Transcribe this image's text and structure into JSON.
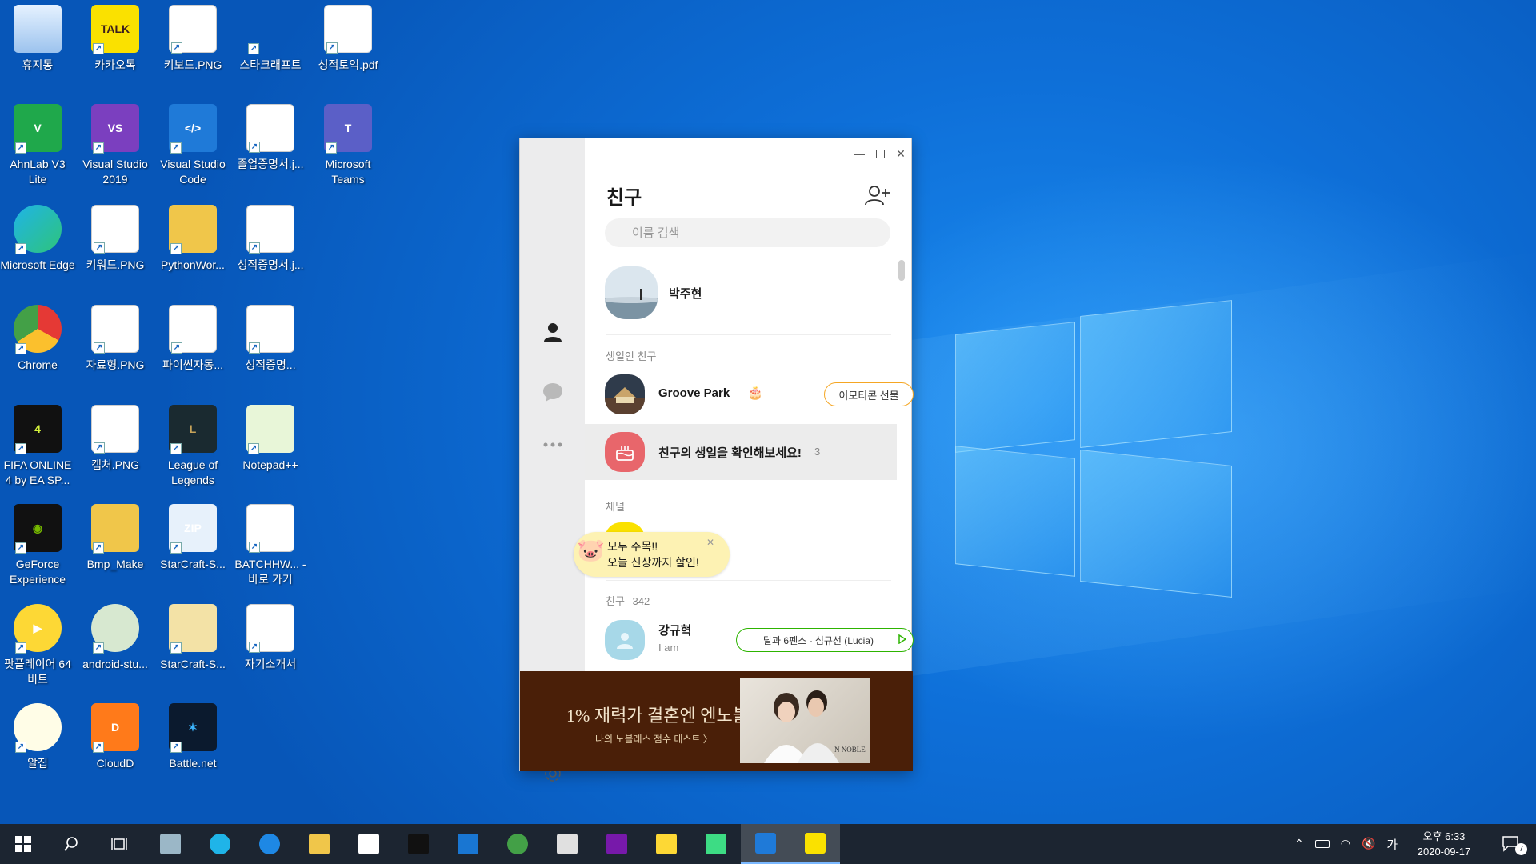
{
  "desktop": {
    "icons": [
      {
        "label": "휴지통",
        "icon": "recycle-bin-icon"
      },
      {
        "label": "카카오톡",
        "icon": "kakaotalk-icon"
      },
      {
        "label": "키보드.PNG",
        "icon": "image-file-icon"
      },
      {
        "label": "스타크래프트",
        "icon": "starcraft-icon"
      },
      {
        "label": "성적토익.pdf",
        "icon": "pdf-file-icon"
      },
      {
        "label": "AhnLab V3 Lite",
        "icon": "ahnlab-icon"
      },
      {
        "label": "Visual Studio 2019",
        "icon": "visual-studio-icon"
      },
      {
        "label": "Visual Studio Code",
        "icon": "vscode-icon"
      },
      {
        "label": "졸업증명서.j...",
        "icon": "image-file-icon"
      },
      {
        "label": "Microsoft Teams",
        "icon": "teams-icon"
      },
      {
        "label": "Microsoft Edge",
        "icon": "edge-icon"
      },
      {
        "label": "키워드.PNG",
        "icon": "image-file-icon"
      },
      {
        "label": "PythonWor...",
        "icon": "folder-icon"
      },
      {
        "label": "성적증명서.j...",
        "icon": "image-file-icon"
      },
      {
        "label": "Chrome",
        "icon": "chrome-icon"
      },
      {
        "label": "자료형.PNG",
        "icon": "image-file-icon"
      },
      {
        "label": "파이썬자동...",
        "icon": "image-file-icon"
      },
      {
        "label": "성적증명...",
        "icon": "image-file-icon"
      },
      {
        "label": "FIFA ONLINE 4 by EA SP...",
        "icon": "fifa-icon"
      },
      {
        "label": "캡처.PNG",
        "icon": "image-file-icon"
      },
      {
        "label": "League of Legends",
        "icon": "lol-icon"
      },
      {
        "label": "Notepad++",
        "icon": "notepadpp-icon"
      },
      {
        "label": "GeForce Experience",
        "icon": "geforce-icon"
      },
      {
        "label": "Bmp_Make",
        "icon": "folder-icon"
      },
      {
        "label": "StarCraft-S...",
        "icon": "zip-icon"
      },
      {
        "label": "BATCHHW... - 바로 가기",
        "icon": "word-doc-icon"
      },
      {
        "label": "팟플레이어 64 비트",
        "icon": "potplayer-icon"
      },
      {
        "label": "android-stu...",
        "icon": "android-studio-icon"
      },
      {
        "label": "StarCraft-S...",
        "icon": "starcraft-folder-icon"
      },
      {
        "label": "자기소개서",
        "icon": "word-doc-icon"
      },
      {
        "label": "알집",
        "icon": "alzip-icon"
      },
      {
        "label": "CloudD",
        "icon": "cloudd-icon"
      },
      {
        "label": "Battle.net",
        "icon": "battlenet-icon"
      }
    ]
  },
  "kakao": {
    "title": "친구",
    "search_placeholder": "이름 검색",
    "profile_name": "박주현",
    "birthday_section": "생일인 친구",
    "birthday_friend": "Groove Park",
    "gift_button": "이모티콘 선물",
    "birthday_check": "친구의 생일을 확인해보세요!",
    "birthday_count": "3",
    "channel_section": "채널",
    "tooltip_line1": "모두 주목!!",
    "tooltip_line2": "오늘 신상까지 할인!",
    "friends_section": "친구",
    "friends_count": "342",
    "friend1_name": "강규혁",
    "friend1_status": "I am",
    "music_pill": "달과 6펜스 - 심규선 (Lucia)",
    "ad_headline": "1% 재력가 결혼엔 엔노블",
    "ad_sub": "나의 노블레스 점수 테스트 〉",
    "ad_brand": "N NOBLE"
  },
  "taskbar": {
    "apps": [
      "start-icon",
      "search-icon",
      "task-view-icon",
      "sticky-app-icon",
      "edge-icon",
      "ie-icon",
      "file-explorer-icon",
      "store-icon",
      "terminal-icon",
      "mail-icon",
      "chrome-icon",
      "paint-icon",
      "onenote-icon",
      "sticky-notes-icon",
      "android-studio-icon",
      "vscode-icon",
      "kakaotalk-icon"
    ],
    "ime": "가",
    "time": "오후 6:33",
    "date": "2020-09-17",
    "notifications": "7"
  },
  "colors": {
    "wallpaper": "#0e6fd8",
    "kakao_yellow": "#fae100",
    "taskbar": "#1c2531",
    "birthday_red": "#e8666b",
    "gift_orange": "#f5a623",
    "music_green": "#2db400"
  }
}
